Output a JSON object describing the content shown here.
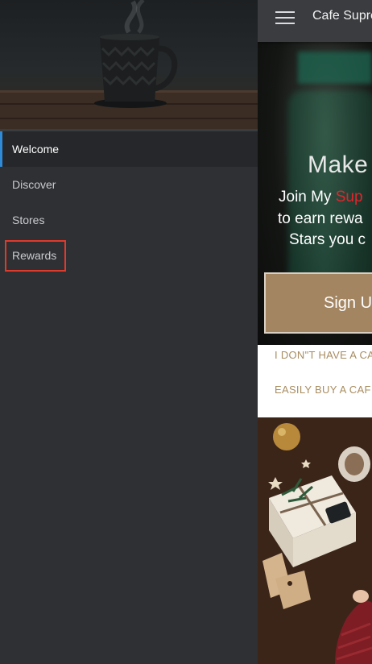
{
  "drawer": {
    "nav_items": [
      {
        "label": "Welcome",
        "active": true
      },
      {
        "label": "Discover",
        "active": false
      },
      {
        "label": "Stores",
        "active": false
      },
      {
        "label": "Rewards",
        "active": false
      }
    ],
    "highlighted_item": "Rewards",
    "accent_color": "#2f8ad8",
    "highlight_color": "#e03a2c"
  },
  "appbar": {
    "menu_icon": "hamburger-icon",
    "title": "Cafe Supre"
  },
  "promo": {
    "heading": "Make",
    "line1_prefix": "Join My ",
    "line1_brand": "Sup",
    "line2": "to earn rewa",
    "line3": "Stars you c",
    "signup_label": "Sign U",
    "brand_color": "#e3242b",
    "button_color": "#a38562"
  },
  "links": {
    "no_card": "I DON\"T HAVE A CA",
    "buy_card": "EASILY BUY A CAF",
    "link_color": "#a88d60"
  }
}
